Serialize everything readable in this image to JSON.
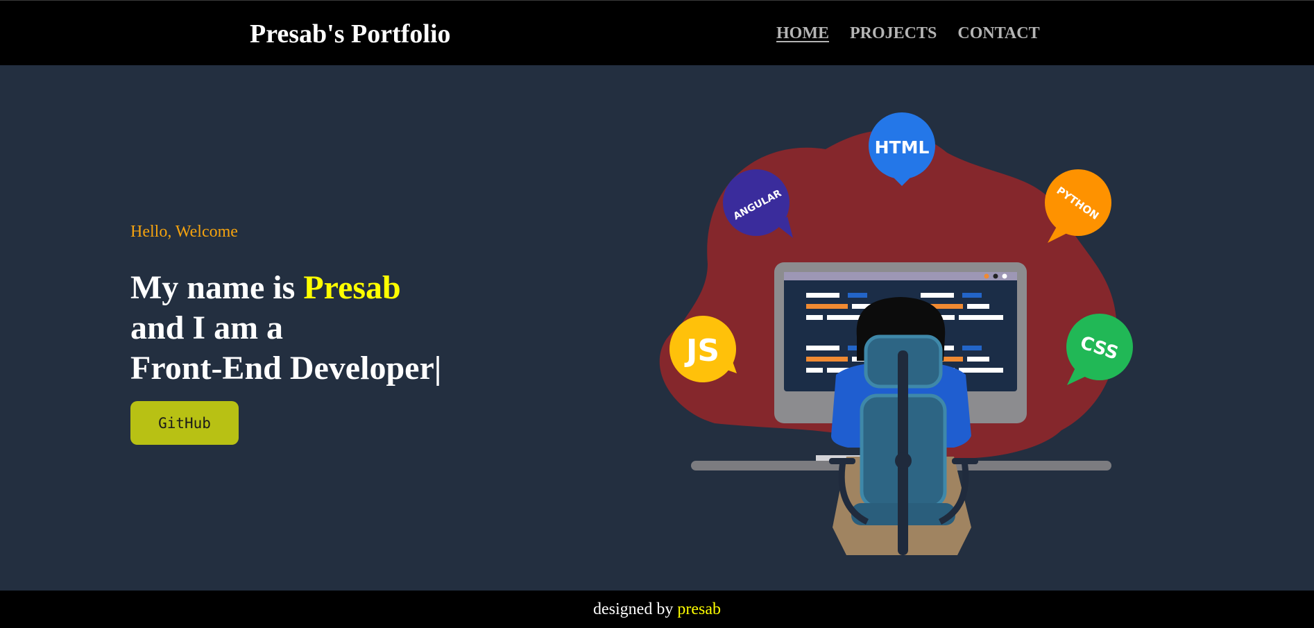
{
  "header": {
    "brand": "Presab's Portfolio",
    "nav": [
      {
        "label": "HOME",
        "active": true
      },
      {
        "label": "PROJECTS",
        "active": false
      },
      {
        "label": "CONTACT",
        "active": false
      }
    ]
  },
  "hero": {
    "greeting": "Hello, Welcome",
    "line1_prefix": "My name is ",
    "name": "Presab",
    "line2": "and I am a",
    "line3": "Front-End Developer|",
    "button_label": "GitHub"
  },
  "illustration": {
    "badges": {
      "html": "HTML",
      "angular": "ANGULAR",
      "python": "PYTHON",
      "js": "JS",
      "css": "CSS"
    }
  },
  "footer": {
    "prefix": "designed by ",
    "author": "presab"
  },
  "colors": {
    "background": "#232f40",
    "bar": "#000000",
    "accent_yellow": "#ffff00",
    "greeting_orange": "#f5a30f",
    "button": "#b8c114",
    "blob": "#85272c"
  }
}
